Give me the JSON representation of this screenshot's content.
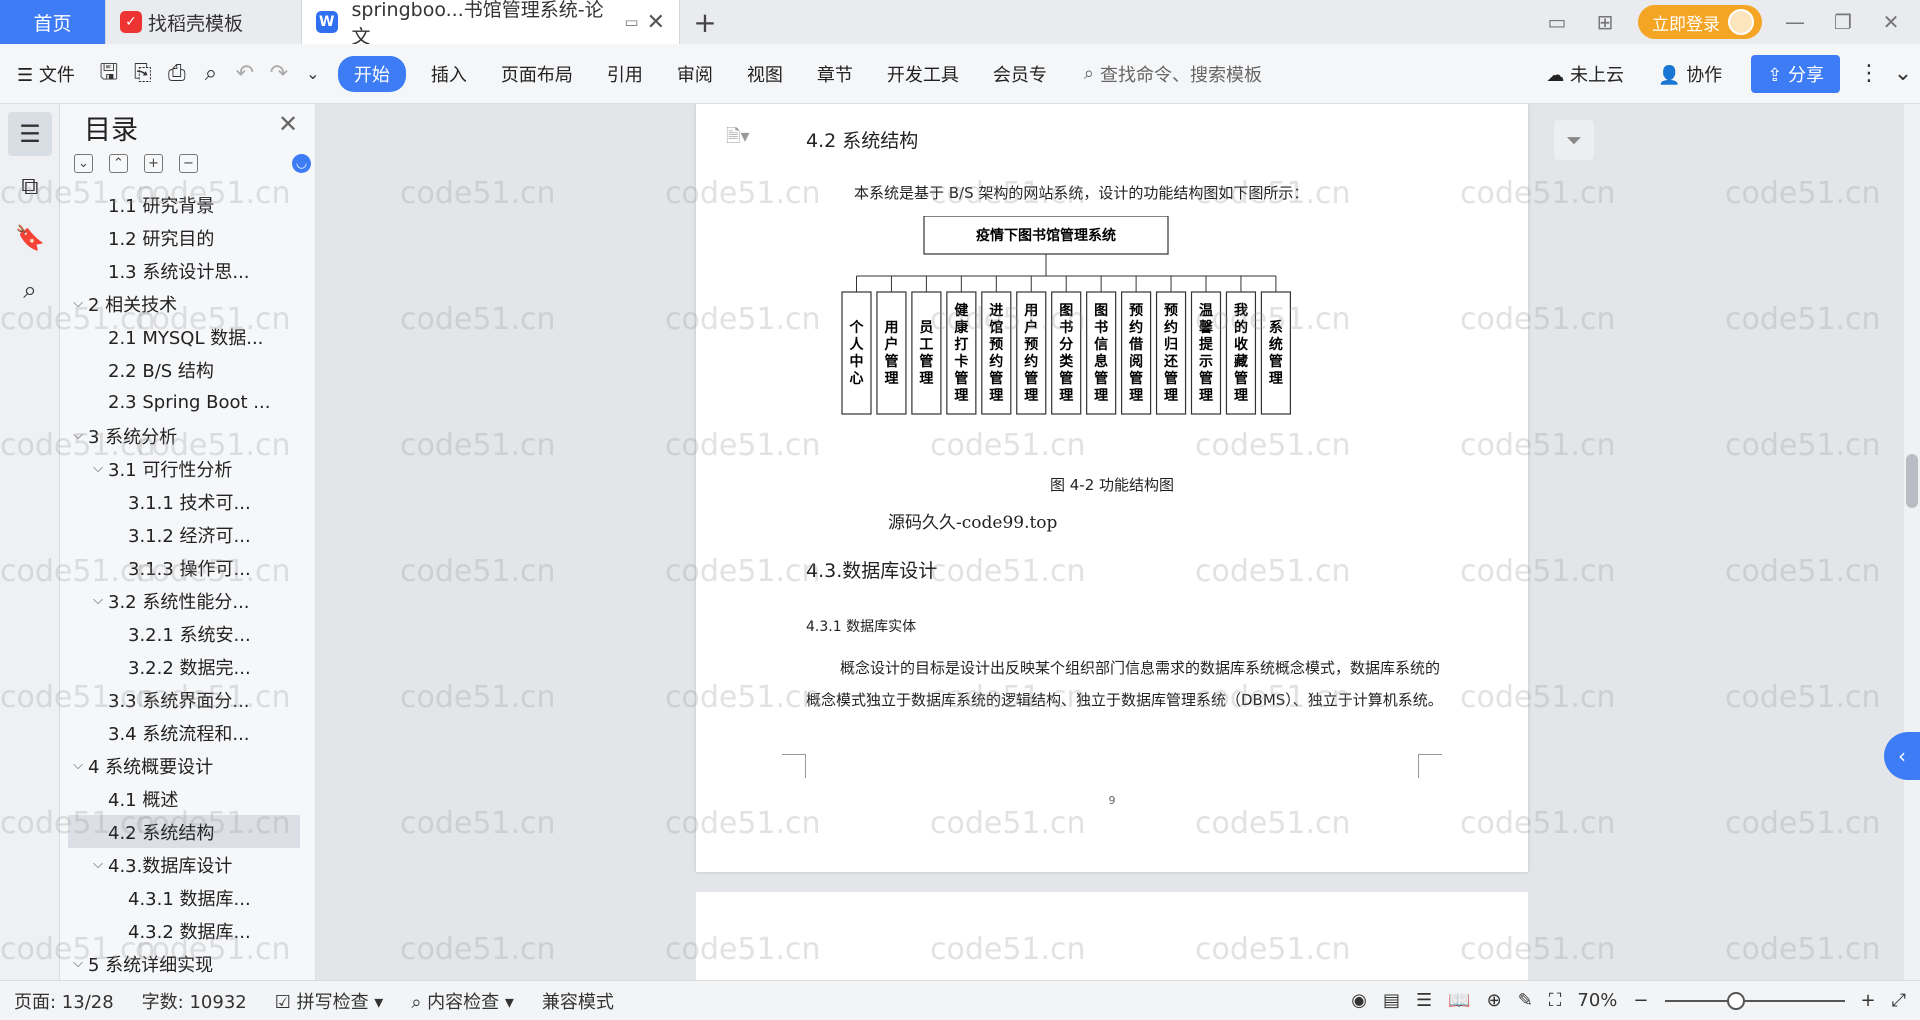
{
  "tabs": {
    "home": "首页",
    "template": "找稻壳模板",
    "document": "springboo...书馆管理系统-论文",
    "login": "立即登录"
  },
  "ribbon": {
    "file": "文件",
    "items": [
      "开始",
      "插入",
      "页面布局",
      "引用",
      "审阅",
      "视图",
      "章节",
      "开发工具",
      "会员专"
    ],
    "search_placeholder": "查找命令、搜索模板",
    "cloud": "未上云",
    "collab": "协作",
    "share": "分享"
  },
  "toc": {
    "title": "目录",
    "items": [
      {
        "label": "1.1 研究背景",
        "level": 2,
        "caret": ""
      },
      {
        "label": "1.2 研究目的",
        "level": 2,
        "caret": ""
      },
      {
        "label": "1.3 系统设计思...",
        "level": 2,
        "caret": ""
      },
      {
        "label": "2 相关技术",
        "level": 1,
        "caret": "⌵"
      },
      {
        "label": "2.1 MYSQL 数据...",
        "level": 2,
        "caret": ""
      },
      {
        "label": "2.2 B/S 结构",
        "level": 2,
        "caret": ""
      },
      {
        "label": "2.3 Spring Boot ...",
        "level": 2,
        "caret": ""
      },
      {
        "label": "3 系统分析",
        "level": 1,
        "caret": "⌵"
      },
      {
        "label": "3.1 可行性分析",
        "level": 2,
        "caret": "⌵"
      },
      {
        "label": "3.1.1 技术可...",
        "level": 3,
        "caret": ""
      },
      {
        "label": "3.1.2 经济可...",
        "level": 3,
        "caret": ""
      },
      {
        "label": "3.1.3 操作可...",
        "level": 3,
        "caret": ""
      },
      {
        "label": "3.2 系统性能分...",
        "level": 2,
        "caret": "⌵"
      },
      {
        "label": "3.2.1  系统安...",
        "level": 3,
        "caret": ""
      },
      {
        "label": "3.2.2  数据完...",
        "level": 3,
        "caret": ""
      },
      {
        "label": "3.3 系统界面分...",
        "level": 2,
        "caret": ""
      },
      {
        "label": "3.4 系统流程和...",
        "level": 2,
        "caret": ""
      },
      {
        "label": "4 系统概要设计",
        "level": 1,
        "caret": "⌵"
      },
      {
        "label": "4.1 概述",
        "level": 2,
        "caret": ""
      },
      {
        "label": "4.2 系统结构",
        "level": 2,
        "caret": "",
        "selected": true
      },
      {
        "label": "4.3.数据库设计",
        "level": 2,
        "caret": "⌵"
      },
      {
        "label": "4.3.1 数据库...",
        "level": 3,
        "caret": ""
      },
      {
        "label": "4.3.2 数据库...",
        "level": 3,
        "caret": ""
      },
      {
        "label": "5 系统详细实现",
        "level": 1,
        "caret": "⌵"
      }
    ]
  },
  "document": {
    "heading_42": "4.2 系统结构",
    "intro": "本系统是基于 B/S 架构的网站系统，设计的功能结构图如下图所示：",
    "figure": {
      "root": "疫情下图书馆管理系统",
      "modules": [
        "个人中心",
        "用户管理",
        "员工管理",
        "健康打卡管理",
        "进馆预约管理",
        "用户预约管理",
        "图书分类管理",
        "图书信息管理",
        "预约借阅管理",
        "预约归还管理",
        "温馨提示管理",
        "我的收藏管理",
        "系统管理"
      ]
    },
    "caption": "图 4-2 功能结构图",
    "source": "源码久久-code99.top",
    "heading_43": "4.3.数据库设计",
    "heading_431": "4.3.1 数据库实体",
    "body": "概念设计的目标是设计出反映某个组织部门信息需求的数据库系统概念模式，数据库系统的概念模式独立于数据库系统的逻辑结构、独立于数据库管理系统（DBMS）、独立于计算机系统。",
    "page_number": "9"
  },
  "status": {
    "page": "页面: 13/28",
    "words": "字数: 10932",
    "spell": "拼写检查",
    "content_check": "内容检查",
    "compat": "兼容模式",
    "zoom": "70%"
  },
  "watermark": "code51.cn",
  "colors": {
    "accent": "#3d7cf5",
    "login": "#f5a524"
  }
}
